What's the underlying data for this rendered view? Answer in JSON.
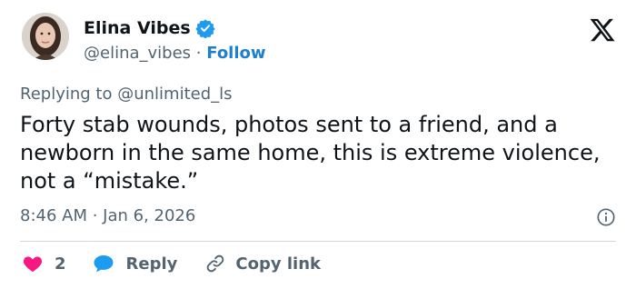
{
  "author": {
    "display_name": "Elina Vibes",
    "handle": "@elina_vibes",
    "separator": "·",
    "follow_label": "Follow",
    "verified": true
  },
  "reply_prefix": "Replying to",
  "reply_to": "@unlimited_ls",
  "tweet_text": "Forty stab wounds, photos sent to a friend, and a newborn in the same home, this is extreme violence, not a “mistake.”",
  "timestamp": "8:46 AM · Jan 6, 2026",
  "actions": {
    "like_count": "2",
    "reply_label": "Reply",
    "copy_link_label": "Copy link"
  },
  "colors": {
    "accent": "#1d9bf0",
    "follow": "#1d7fce",
    "like": "#f91880",
    "secondary_text": "#536471"
  },
  "icons": [
    "x-logo-icon",
    "verified-badge-icon",
    "info-icon",
    "heart-icon",
    "reply-bubble-icon",
    "link-icon"
  ]
}
